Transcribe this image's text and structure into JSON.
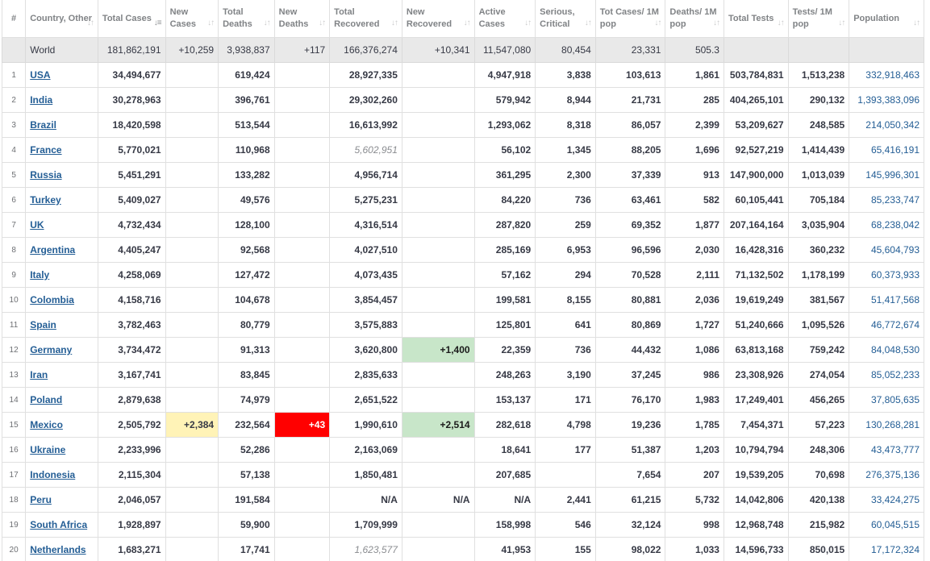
{
  "columns": [
    {
      "key": "idx",
      "label": "#",
      "sortable": false
    },
    {
      "key": "country",
      "label": "Country, Other",
      "sortable": true
    },
    {
      "key": "total_cases",
      "label": "Total Cases",
      "sortable": true,
      "active": true
    },
    {
      "key": "new_cases",
      "label": "New Cases",
      "sortable": true
    },
    {
      "key": "total_deaths",
      "label": "Total Deaths",
      "sortable": true
    },
    {
      "key": "new_deaths",
      "label": "New Deaths",
      "sortable": true
    },
    {
      "key": "total_recovered",
      "label": "Total Recovered",
      "sortable": true
    },
    {
      "key": "new_recovered",
      "label": "New Recovered",
      "sortable": true
    },
    {
      "key": "active_cases",
      "label": "Active Cases",
      "sortable": true
    },
    {
      "key": "serious",
      "label": "Serious, Critical",
      "sortable": true
    },
    {
      "key": "cases_per_m",
      "label": "Tot Cases/ 1M pop",
      "sortable": true
    },
    {
      "key": "deaths_per_m",
      "label": "Deaths/ 1M pop",
      "sortable": true
    },
    {
      "key": "total_tests",
      "label": "Total Tests",
      "sortable": true
    },
    {
      "key": "tests_per_m",
      "label": "Tests/ 1M pop",
      "sortable": true
    },
    {
      "key": "population",
      "label": "Population",
      "sortable": true
    }
  ],
  "sort_icon": "sort-arrows-icon",
  "world": {
    "country": "World",
    "total_cases": "181,862,191",
    "new_cases": "+10,259",
    "total_deaths": "3,938,837",
    "new_deaths": "+117",
    "total_recovered": "166,376,274",
    "new_recovered": "+10,341",
    "active_cases": "11,547,080",
    "serious": "80,454",
    "cases_per_m": "23,331",
    "deaths_per_m": "505.3",
    "total_tests": "",
    "tests_per_m": "",
    "population": ""
  },
  "rows": [
    {
      "idx": "1",
      "country": "USA",
      "total_cases": "34,494,677",
      "new_cases": "",
      "total_deaths": "619,424",
      "new_deaths": "",
      "total_recovered": "28,927,335",
      "new_recovered": "",
      "active_cases": "4,947,918",
      "serious": "3,838",
      "cases_per_m": "103,613",
      "deaths_per_m": "1,861",
      "total_tests": "503,784,831",
      "tests_per_m": "1,513,238",
      "population": "332,918,463"
    },
    {
      "idx": "2",
      "country": "India",
      "total_cases": "30,278,963",
      "new_cases": "",
      "total_deaths": "396,761",
      "new_deaths": "",
      "total_recovered": "29,302,260",
      "new_recovered": "",
      "active_cases": "579,942",
      "serious": "8,944",
      "cases_per_m": "21,731",
      "deaths_per_m": "285",
      "total_tests": "404,265,101",
      "tests_per_m": "290,132",
      "population": "1,393,383,096"
    },
    {
      "idx": "3",
      "country": "Brazil",
      "total_cases": "18,420,598",
      "new_cases": "",
      "total_deaths": "513,544",
      "new_deaths": "",
      "total_recovered": "16,613,992",
      "new_recovered": "",
      "active_cases": "1,293,062",
      "serious": "8,318",
      "cases_per_m": "86,057",
      "deaths_per_m": "2,399",
      "total_tests": "53,209,627",
      "tests_per_m": "248,585",
      "population": "214,050,342"
    },
    {
      "idx": "4",
      "country": "France",
      "total_cases": "5,770,021",
      "new_cases": "",
      "total_deaths": "110,968",
      "new_deaths": "",
      "total_recovered": "5,602,951",
      "recovered_estimated": true,
      "new_recovered": "",
      "active_cases": "56,102",
      "serious": "1,345",
      "cases_per_m": "88,205",
      "deaths_per_m": "1,696",
      "total_tests": "92,527,219",
      "tests_per_m": "1,414,439",
      "population": "65,416,191"
    },
    {
      "idx": "5",
      "country": "Russia",
      "total_cases": "5,451,291",
      "new_cases": "",
      "total_deaths": "133,282",
      "new_deaths": "",
      "total_recovered": "4,956,714",
      "new_recovered": "",
      "active_cases": "361,295",
      "serious": "2,300",
      "cases_per_m": "37,339",
      "deaths_per_m": "913",
      "total_tests": "147,900,000",
      "tests_per_m": "1,013,039",
      "population": "145,996,301"
    },
    {
      "idx": "6",
      "country": "Turkey",
      "total_cases": "5,409,027",
      "new_cases": "",
      "total_deaths": "49,576",
      "new_deaths": "",
      "total_recovered": "5,275,231",
      "new_recovered": "",
      "active_cases": "84,220",
      "serious": "736",
      "cases_per_m": "63,461",
      "deaths_per_m": "582",
      "total_tests": "60,105,441",
      "tests_per_m": "705,184",
      "population": "85,233,747"
    },
    {
      "idx": "7",
      "country": "UK",
      "total_cases": "4,732,434",
      "new_cases": "",
      "total_deaths": "128,100",
      "new_deaths": "",
      "total_recovered": "4,316,514",
      "new_recovered": "",
      "active_cases": "287,820",
      "serious": "259",
      "cases_per_m": "69,352",
      "deaths_per_m": "1,877",
      "total_tests": "207,164,164",
      "tests_per_m": "3,035,904",
      "population": "68,238,042"
    },
    {
      "idx": "8",
      "country": "Argentina",
      "total_cases": "4,405,247",
      "new_cases": "",
      "total_deaths": "92,568",
      "new_deaths": "",
      "total_recovered": "4,027,510",
      "new_recovered": "",
      "active_cases": "285,169",
      "serious": "6,953",
      "cases_per_m": "96,596",
      "deaths_per_m": "2,030",
      "total_tests": "16,428,316",
      "tests_per_m": "360,232",
      "population": "45,604,793"
    },
    {
      "idx": "9",
      "country": "Italy",
      "total_cases": "4,258,069",
      "new_cases": "",
      "total_deaths": "127,472",
      "new_deaths": "",
      "total_recovered": "4,073,435",
      "new_recovered": "",
      "active_cases": "57,162",
      "serious": "294",
      "cases_per_m": "70,528",
      "deaths_per_m": "2,111",
      "total_tests": "71,132,502",
      "tests_per_m": "1,178,199",
      "population": "60,373,933"
    },
    {
      "idx": "10",
      "country": "Colombia",
      "total_cases": "4,158,716",
      "new_cases": "",
      "total_deaths": "104,678",
      "new_deaths": "",
      "total_recovered": "3,854,457",
      "new_recovered": "",
      "active_cases": "199,581",
      "serious": "8,155",
      "cases_per_m": "80,881",
      "deaths_per_m": "2,036",
      "total_tests": "19,619,249",
      "tests_per_m": "381,567",
      "population": "51,417,568"
    },
    {
      "idx": "11",
      "country": "Spain",
      "total_cases": "3,782,463",
      "new_cases": "",
      "total_deaths": "80,779",
      "new_deaths": "",
      "total_recovered": "3,575,883",
      "new_recovered": "",
      "active_cases": "125,801",
      "serious": "641",
      "cases_per_m": "80,869",
      "deaths_per_m": "1,727",
      "total_tests": "51,240,666",
      "tests_per_m": "1,095,526",
      "population": "46,772,674"
    },
    {
      "idx": "12",
      "country": "Germany",
      "total_cases": "3,734,472",
      "new_cases": "",
      "total_deaths": "91,313",
      "new_deaths": "",
      "total_recovered": "3,620,800",
      "new_recovered": "+1,400",
      "active_cases": "22,359",
      "serious": "736",
      "cases_per_m": "44,432",
      "deaths_per_m": "1,086",
      "total_tests": "63,813,168",
      "tests_per_m": "759,242",
      "population": "84,048,530"
    },
    {
      "idx": "13",
      "country": "Iran",
      "total_cases": "3,167,741",
      "new_cases": "",
      "total_deaths": "83,845",
      "new_deaths": "",
      "total_recovered": "2,835,633",
      "new_recovered": "",
      "active_cases": "248,263",
      "serious": "3,190",
      "cases_per_m": "37,245",
      "deaths_per_m": "986",
      "total_tests": "23,308,926",
      "tests_per_m": "274,054",
      "population": "85,052,233"
    },
    {
      "idx": "14",
      "country": "Poland",
      "total_cases": "2,879,638",
      "new_cases": "",
      "total_deaths": "74,979",
      "new_deaths": "",
      "total_recovered": "2,651,522",
      "new_recovered": "",
      "active_cases": "153,137",
      "serious": "171",
      "cases_per_m": "76,170",
      "deaths_per_m": "1,983",
      "total_tests": "17,249,401",
      "tests_per_m": "456,265",
      "population": "37,805,635"
    },
    {
      "idx": "15",
      "country": "Mexico",
      "total_cases": "2,505,792",
      "new_cases": "+2,384",
      "total_deaths": "232,564",
      "new_deaths": "+43",
      "total_recovered": "1,990,610",
      "new_recovered": "+2,514",
      "active_cases": "282,618",
      "serious": "4,798",
      "cases_per_m": "19,236",
      "deaths_per_m": "1,785",
      "total_tests": "7,454,371",
      "tests_per_m": "57,223",
      "population": "130,268,281"
    },
    {
      "idx": "16",
      "country": "Ukraine",
      "total_cases": "2,233,996",
      "new_cases": "",
      "total_deaths": "52,286",
      "new_deaths": "",
      "total_recovered": "2,163,069",
      "new_recovered": "",
      "active_cases": "18,641",
      "serious": "177",
      "cases_per_m": "51,387",
      "deaths_per_m": "1,203",
      "total_tests": "10,794,794",
      "tests_per_m": "248,306",
      "population": "43,473,777"
    },
    {
      "idx": "17",
      "country": "Indonesia",
      "total_cases": "2,115,304",
      "new_cases": "",
      "total_deaths": "57,138",
      "new_deaths": "",
      "total_recovered": "1,850,481",
      "new_recovered": "",
      "active_cases": "207,685",
      "serious": "",
      "cases_per_m": "7,654",
      "deaths_per_m": "207",
      "total_tests": "19,539,205",
      "tests_per_m": "70,698",
      "population": "276,375,136"
    },
    {
      "idx": "18",
      "country": "Peru",
      "total_cases": "2,046,057",
      "new_cases": "",
      "total_deaths": "191,584",
      "new_deaths": "",
      "total_recovered": "N/A",
      "new_recovered": "N/A",
      "active_cases": "N/A",
      "serious": "2,441",
      "cases_per_m": "61,215",
      "deaths_per_m": "5,732",
      "total_tests": "14,042,806",
      "tests_per_m": "420,138",
      "population": "33,424,275"
    },
    {
      "idx": "19",
      "country": "South Africa",
      "total_cases": "1,928,897",
      "new_cases": "",
      "total_deaths": "59,900",
      "new_deaths": "",
      "total_recovered": "1,709,999",
      "new_recovered": "",
      "active_cases": "158,998",
      "serious": "546",
      "cases_per_m": "32,124",
      "deaths_per_m": "998",
      "total_tests": "12,968,748",
      "tests_per_m": "215,982",
      "population": "60,045,515"
    },
    {
      "idx": "20",
      "country": "Netherlands",
      "total_cases": "1,683,271",
      "new_cases": "",
      "total_deaths": "17,741",
      "new_deaths": "",
      "total_recovered": "1,623,577",
      "recovered_estimated": true,
      "new_recovered": "",
      "active_cases": "41,953",
      "serious": "155",
      "cases_per_m": "98,022",
      "deaths_per_m": "1,033",
      "total_tests": "14,596,733",
      "tests_per_m": "850,015",
      "population": "17,172,324"
    }
  ],
  "colors": {
    "header_text": "#808386",
    "cell_text": "#363945",
    "link": "#245e95",
    "world_bg": "#e9e9e9",
    "new_cases_bg": "#fff3b7",
    "new_deaths_bg": "#ff0000",
    "new_recovered_bg": "#c8e6c9",
    "border": "#e0e0e0"
  }
}
